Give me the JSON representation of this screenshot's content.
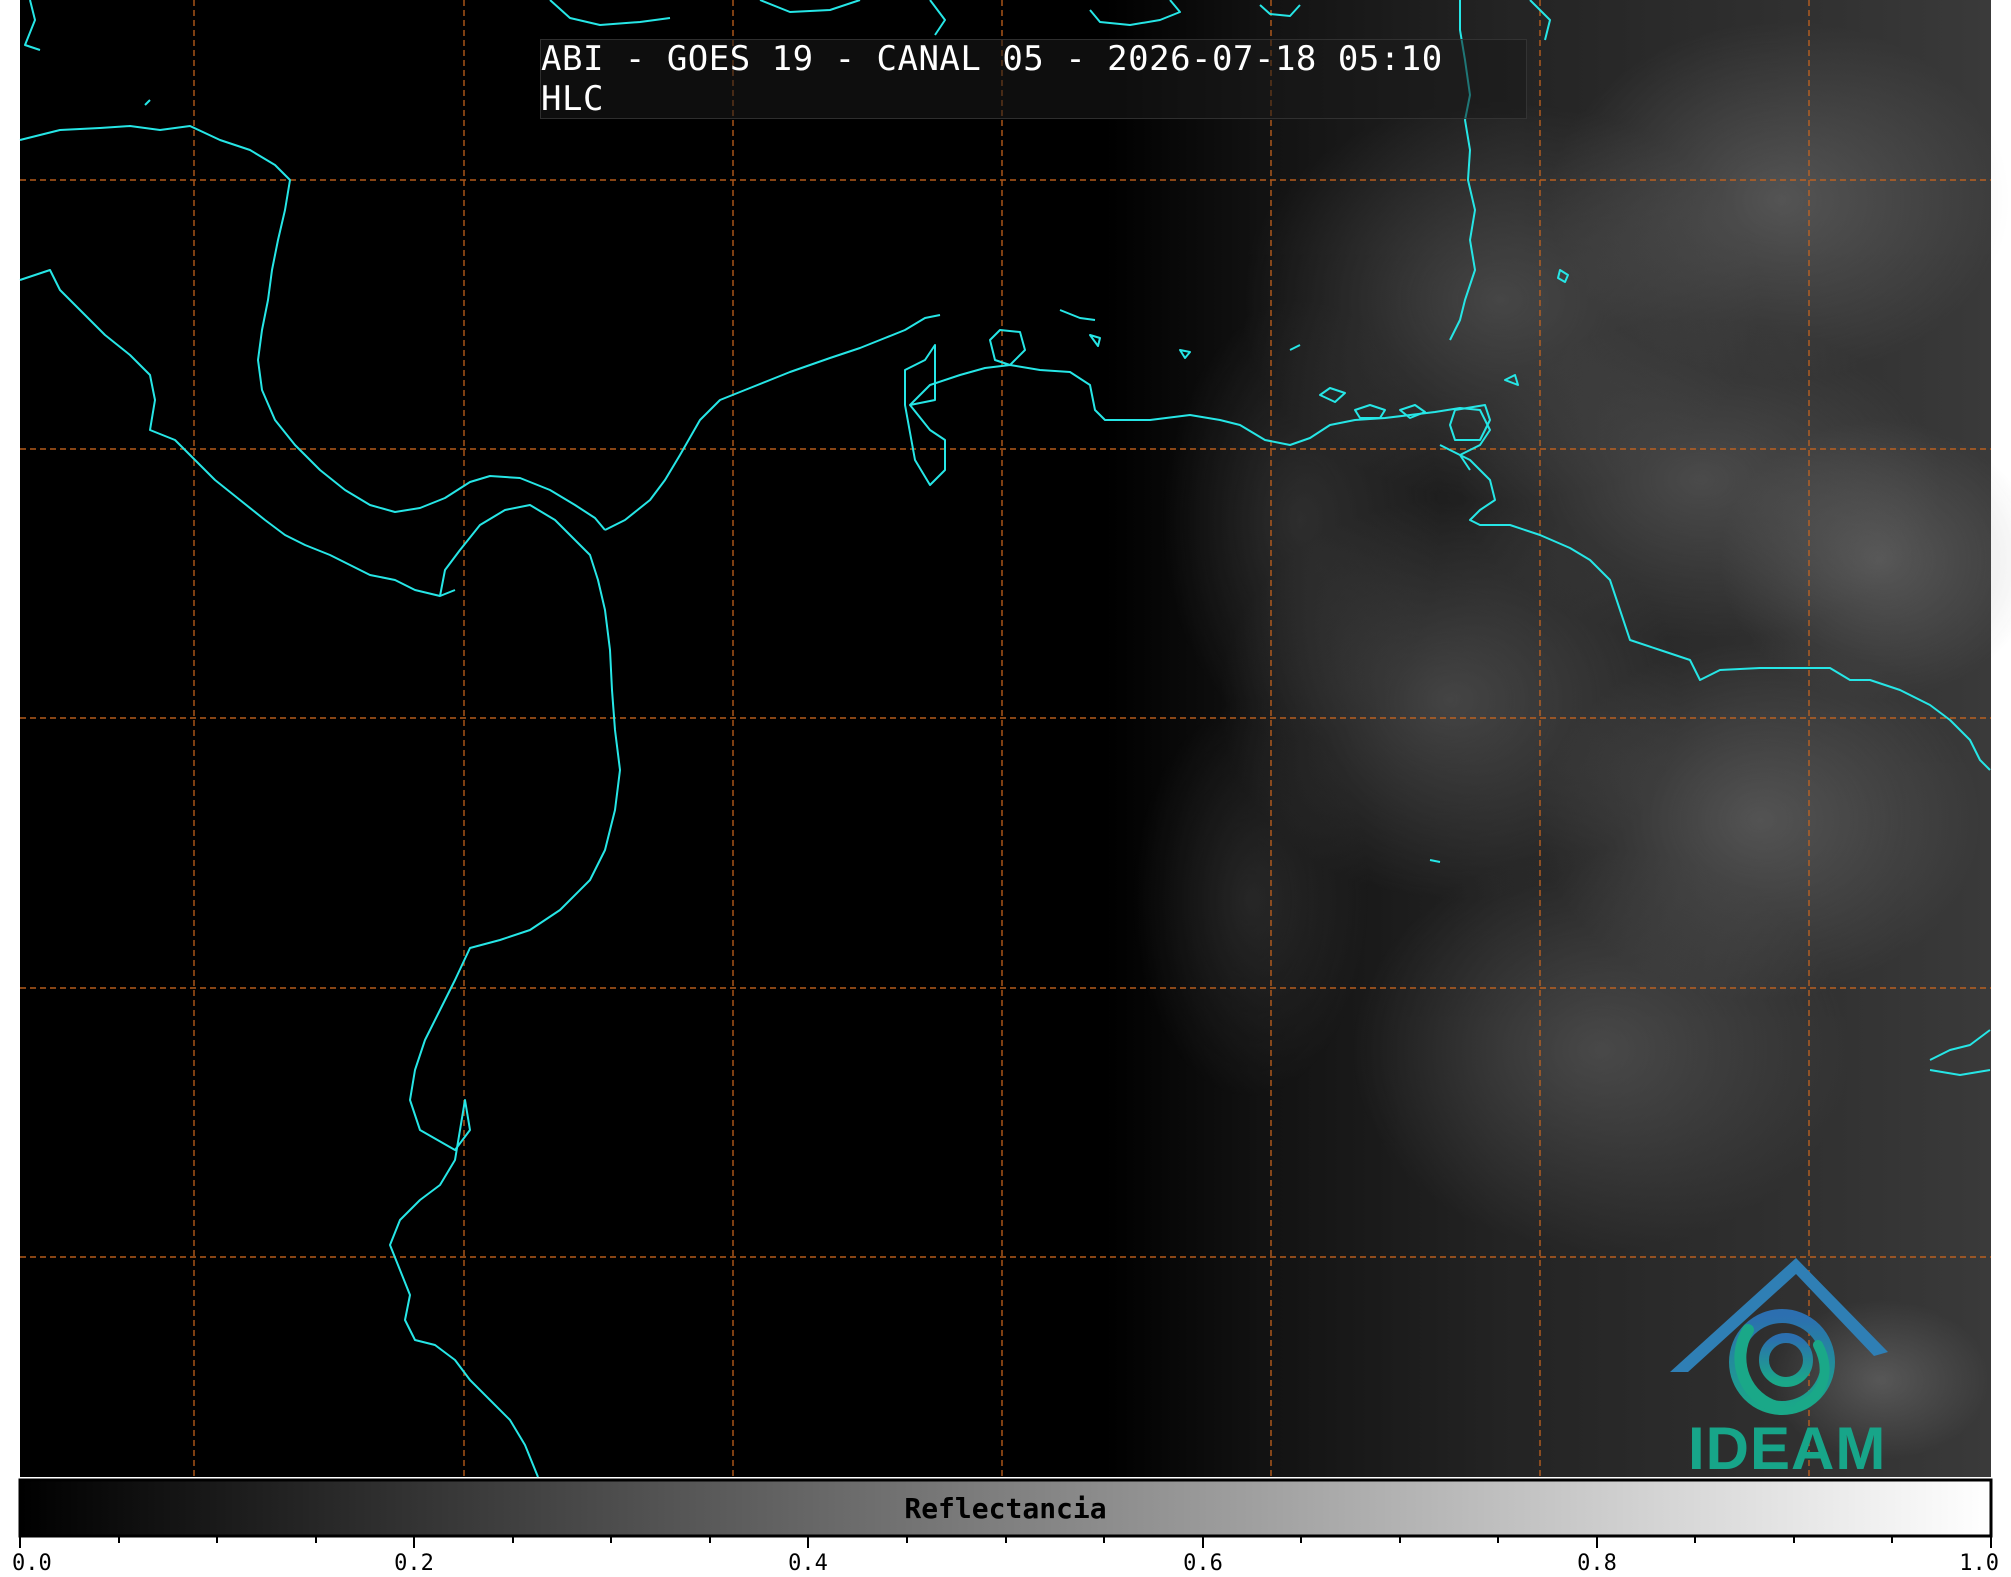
{
  "title": "ABI - GOES 19 - CANAL 05 - 2026-07-18 05:10 HLC",
  "colorbar": {
    "label": "Reflectancia",
    "ticks": [
      "0.0",
      "0.2",
      "0.4",
      "0.6",
      "0.8",
      "1.0"
    ],
    "range": [
      0.0,
      1.0
    ]
  },
  "logo": {
    "text": "IDEAM",
    "icon": "ideam-mountain-swirl-logo"
  },
  "colors": {
    "coastline": "#26e6e6",
    "gridline": "#c8641e",
    "logo": "#17a589",
    "logo_roof": "#2f7fb5"
  }
}
